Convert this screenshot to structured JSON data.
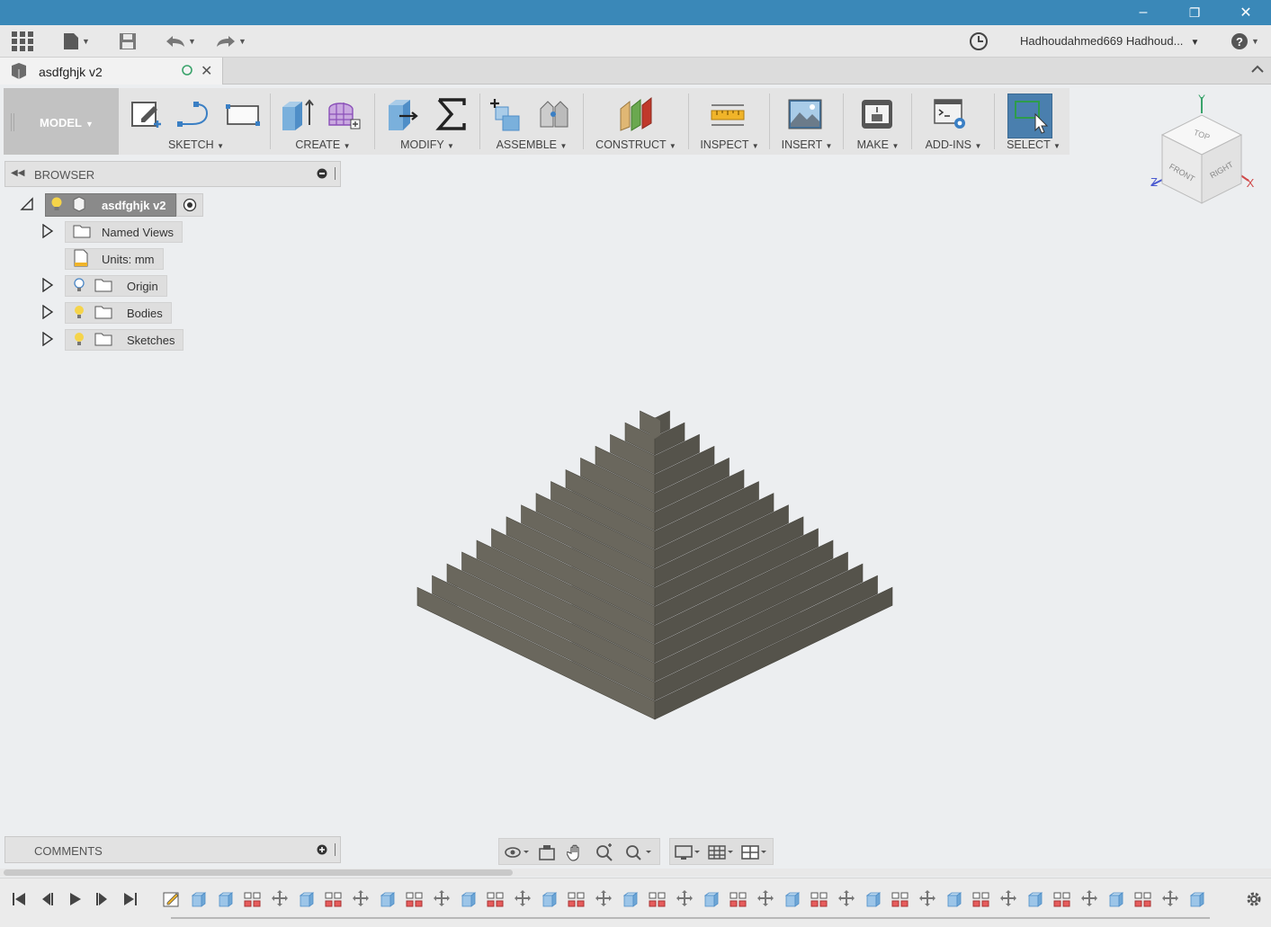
{
  "window": {
    "minimize": "–",
    "restore": "❐",
    "close": "✕"
  },
  "appbar": {
    "user_name": "Hadhoudahmed669 Hadhoud...",
    "icons": [
      "grid-menu-icon",
      "file-icon",
      "save-icon",
      "undo-icon",
      "redo-icon",
      "history-clock-icon",
      "help-icon"
    ]
  },
  "tab": {
    "title": "asdfghjk v2"
  },
  "ribbon": {
    "workspace": "MODEL",
    "groups": [
      {
        "label": "SKETCH"
      },
      {
        "label": "CREATE"
      },
      {
        "label": "MODIFY"
      },
      {
        "label": "ASSEMBLE"
      },
      {
        "label": "CONSTRUCT"
      },
      {
        "label": "INSPECT"
      },
      {
        "label": "INSERT"
      },
      {
        "label": "MAKE"
      },
      {
        "label": "ADD-INS"
      },
      {
        "label": "SELECT"
      }
    ]
  },
  "viewcube": {
    "top": "TOP",
    "front": "FRONT",
    "right": "RIGHT",
    "x": "X",
    "y": "Y",
    "z": "Z"
  },
  "browser": {
    "title": "BROWSER",
    "root": "asdfghjk v2",
    "items": [
      {
        "label": "Named Views"
      },
      {
        "label": "Units: mm"
      },
      {
        "label": "Origin"
      },
      {
        "label": "Bodies"
      },
      {
        "label": "Sketches"
      }
    ]
  },
  "comments": {
    "title": "COMMENTS"
  },
  "colors": {
    "titlebar": "#3a88b8",
    "select_active": "#4a7fae",
    "pyramid_light": "#6a675d",
    "pyramid_dark": "#55534b"
  }
}
